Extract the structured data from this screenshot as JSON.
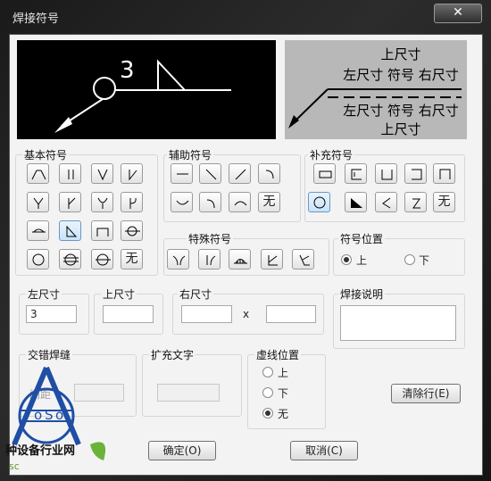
{
  "window": {
    "title": "焊接符号",
    "close_label": "✕"
  },
  "preview": {
    "left_number": "3",
    "right_lines": [
      "上尺寸",
      "左尺寸 符号 右尺寸",
      "左尺寸 符号 右尺寸",
      "上尺寸"
    ]
  },
  "basic_symbols": {
    "label": "基本符号"
  },
  "aux_symbols": {
    "label": "辅助符号",
    "none_label": "无"
  },
  "supp_symbols": {
    "label": "补充符号",
    "none_label": "无"
  },
  "special_symbols": {
    "label": "特殊符号"
  },
  "symbol_position": {
    "label": "符号位置",
    "options": [
      "上",
      "下"
    ],
    "selected": "上"
  },
  "dims": {
    "left_label": "左尺寸",
    "left_value": "3",
    "top_label": "上尺寸",
    "top_value": "",
    "right_label": "右尺寸",
    "right_value": "",
    "times": "x",
    "count_value": ""
  },
  "weld_note": {
    "label": "焊接说明",
    "value": ""
  },
  "staggered": {
    "label": "交错焊缝",
    "gap_label": "间距",
    "gap_value": ""
  },
  "extended_text": {
    "label": "扩充文字",
    "value": ""
  },
  "dash_position": {
    "label": "虚线位置",
    "options": [
      "上",
      "下",
      "无"
    ],
    "selected": "无"
  },
  "buttons": {
    "clear": "清除行(E)",
    "ok": "确定(O)",
    "cancel": "取消(C)"
  },
  "basic_none_label": "无",
  "watermark": {
    "text": "种设备行业网",
    "url": "sc"
  }
}
